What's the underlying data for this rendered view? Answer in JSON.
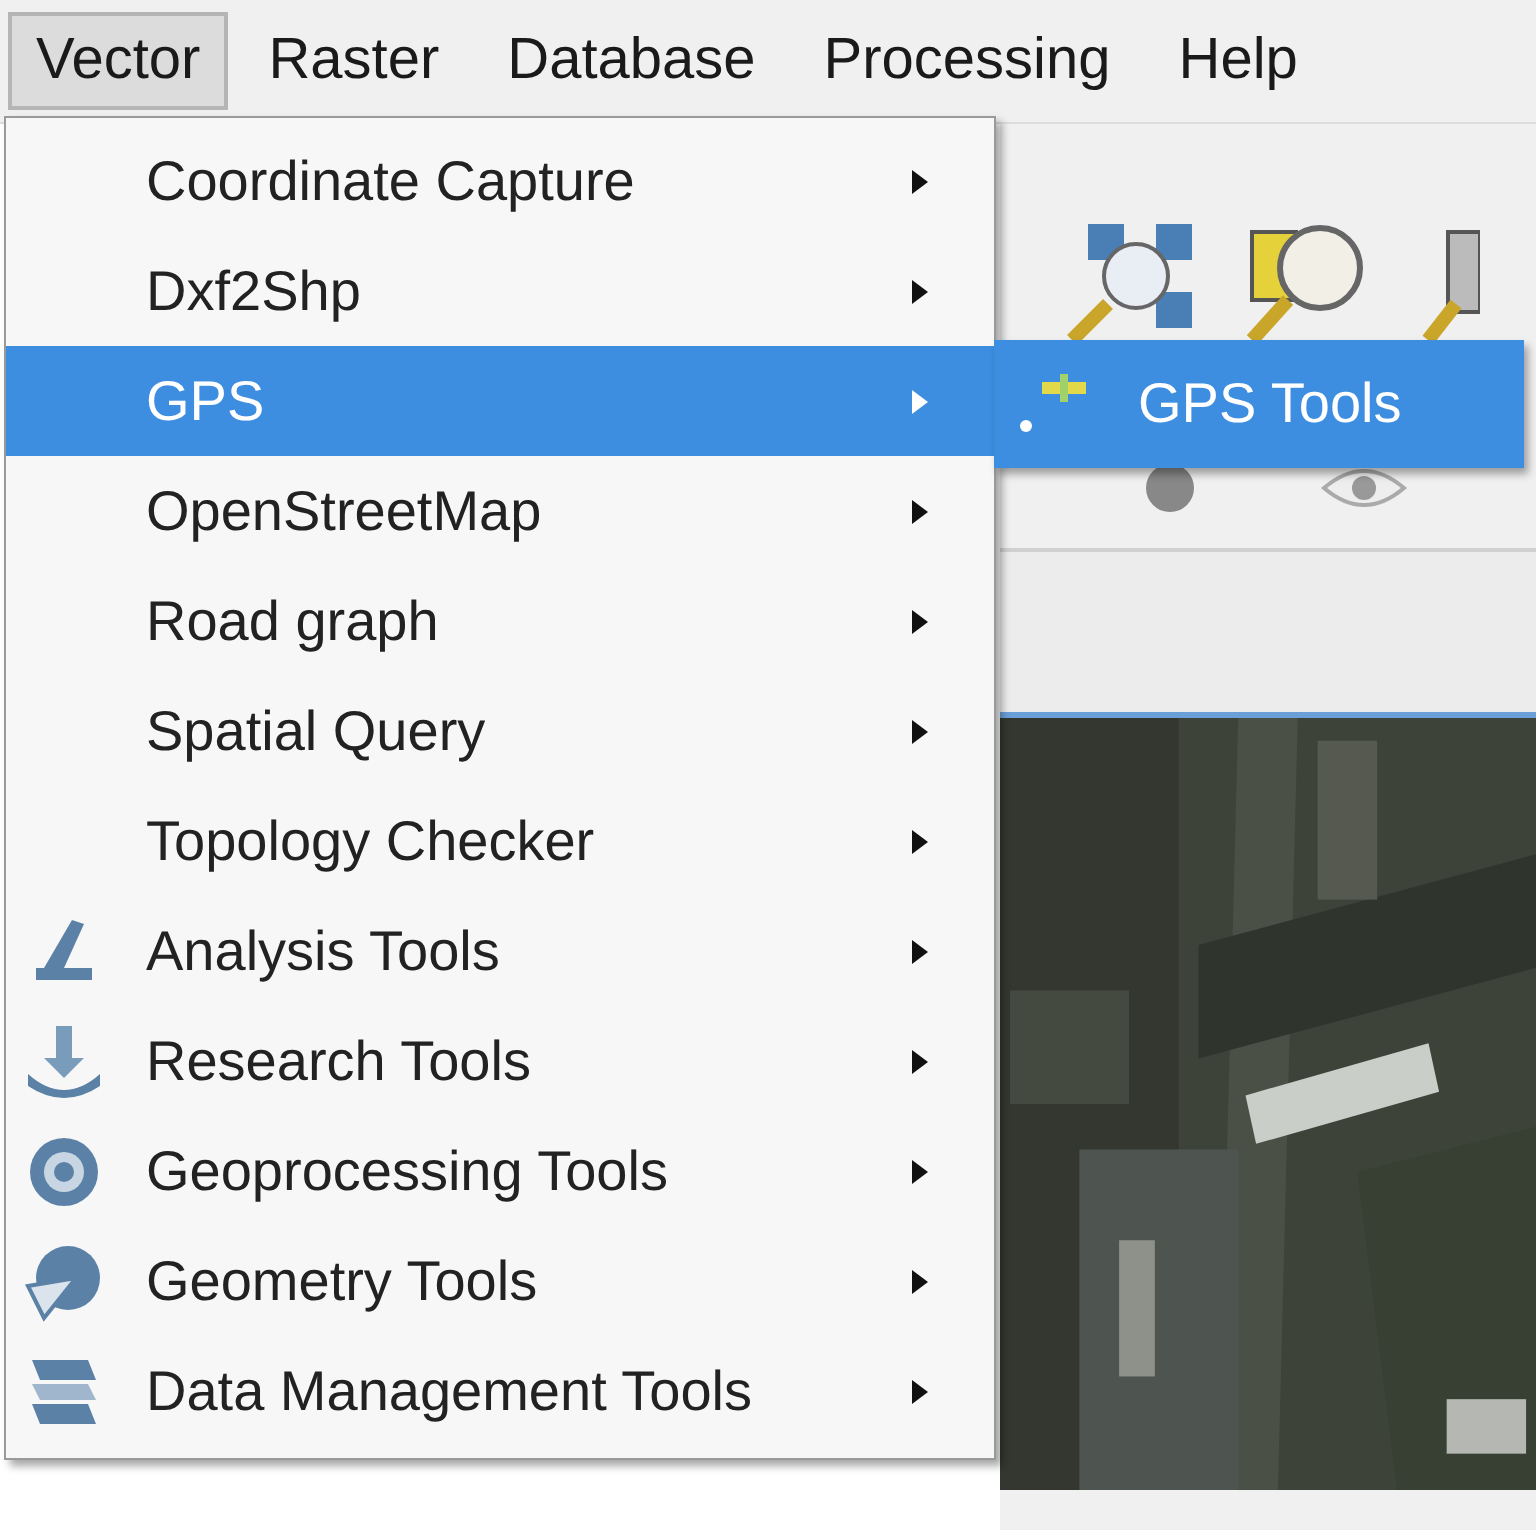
{
  "menubar": [
    {
      "label": "Vector",
      "selected": true
    },
    {
      "label": "Raster",
      "selected": false
    },
    {
      "label": "Database",
      "selected": false
    },
    {
      "label": "Processing",
      "selected": false
    },
    {
      "label": "Help",
      "selected": false
    }
  ],
  "menu": {
    "items": [
      {
        "label": "Coordinate Capture",
        "selected": false,
        "has_submenu": true
      },
      {
        "label": "Dxf2Shp",
        "selected": false,
        "has_submenu": true
      },
      {
        "label": "GPS",
        "selected": true,
        "has_submenu": true
      },
      {
        "label": "OpenStreetMap",
        "selected": false,
        "has_submenu": true
      },
      {
        "label": "Road graph",
        "selected": false,
        "has_submenu": true
      },
      {
        "label": "Spatial Query",
        "selected": false,
        "has_submenu": true
      },
      {
        "label": "Topology Checker",
        "selected": false,
        "has_submenu": true
      },
      {
        "label": "Analysis Tools",
        "selected": false,
        "has_submenu": true
      },
      {
        "label": "Research Tools",
        "selected": false,
        "has_submenu": true
      },
      {
        "label": "Geoprocessing Tools",
        "selected": false,
        "has_submenu": true
      },
      {
        "label": "Geometry Tools",
        "selected": false,
        "has_submenu": true
      },
      {
        "label": "Data Management Tools",
        "selected": false,
        "has_submenu": true
      }
    ]
  },
  "submenu": {
    "items": [
      {
        "label": "GPS Tools",
        "selected": true
      }
    ]
  }
}
